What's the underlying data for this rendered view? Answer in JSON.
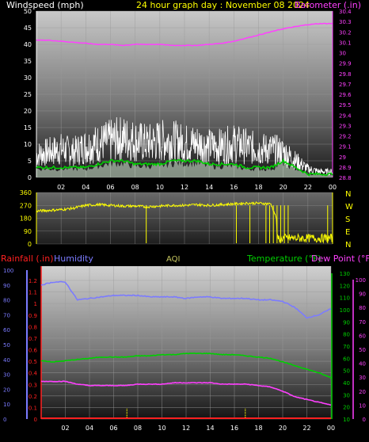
{
  "header": {
    "wind_label": "Windspeed (mph)",
    "day_label": "24 hour graph day : November 08 2024",
    "baro_label": "Barometer (.in)"
  },
  "lower_header": {
    "rain_label": "Rainfall (.in)",
    "humidity_label": "Humidity",
    "aqi_label": "AQI",
    "temp_label": "Temperature (°F)",
    "dew_label": "Dew Point (°F)"
  },
  "colors": {
    "wind_axis": "#ffffff",
    "barometer": "#ff40ff",
    "avg_wind": "#00d000",
    "gust": "#ffffff",
    "wind_dir": "#ffff00",
    "rain": "#ff2020",
    "humidity": "#7b7bff",
    "temperature": "#00d000",
    "dew_point": "#ff40ff"
  },
  "chart_data": [
    {
      "type": "line",
      "title": "24 hour graph day : November 08 2024",
      "x_ticks": [
        "02",
        "04",
        "06",
        "08",
        "10",
        "12",
        "14",
        "16",
        "18",
        "20",
        "22",
        "00"
      ],
      "left_axis": {
        "label": "Windspeed (mph)",
        "range": [
          0,
          50
        ],
        "ticks": [
          "0",
          "5",
          "10",
          "15",
          "20",
          "25",
          "30",
          "35",
          "40",
          "45",
          "50"
        ]
      },
      "right_axis": {
        "label": "Barometer (.in)",
        "range": [
          28.8,
          30.4
        ],
        "ticks": [
          "28.8",
          "28.9",
          "29",
          "29.1",
          "29.2",
          "29.3",
          "29.4",
          "29.5",
          "29.6",
          "29.7",
          "29.8",
          "29.9",
          "30",
          "30.1",
          "30.2",
          "30.3",
          "30.4"
        ]
      },
      "series": [
        {
          "name": "Barometer (.in)",
          "x": [
            0,
            1,
            2,
            3,
            4,
            5,
            6,
            7,
            8,
            9,
            10,
            11,
            12,
            13,
            14,
            15,
            16,
            17,
            18,
            19,
            20,
            21,
            22,
            23,
            24
          ],
          "values": [
            30.12,
            30.12,
            30.11,
            30.1,
            30.09,
            30.08,
            30.08,
            30.07,
            30.08,
            30.08,
            30.08,
            30.07,
            30.07,
            30.07,
            30.08,
            30.09,
            30.11,
            30.14,
            30.17,
            30.2,
            30.23,
            30.25,
            30.27,
            30.28,
            30.28
          ]
        },
        {
          "x": [
            0,
            1,
            2,
            3,
            4,
            5,
            6,
            7,
            8,
            9,
            10,
            11,
            12,
            13,
            14,
            15,
            16,
            17,
            18,
            19,
            20,
            21,
            22,
            23,
            24
          ],
          "values": [
            8,
            9,
            10,
            9,
            11,
            12,
            13,
            14,
            13,
            12,
            13,
            13,
            12,
            12,
            11,
            11,
            12,
            11,
            10,
            10,
            9,
            6,
            3,
            2,
            2
          ]
        },
        {
          "x": [
            0,
            1,
            2,
            3,
            4,
            5,
            6,
            7,
            8,
            9,
            10,
            11,
            12,
            13,
            14,
            15,
            16,
            17,
            18,
            19,
            20,
            21,
            22,
            23,
            24
          ],
          "values": [
            3,
            3,
            3,
            3,
            3,
            4,
            5,
            5,
            4,
            4,
            4,
            5,
            5,
            5,
            4,
            4,
            4,
            3,
            3,
            3,
            5,
            3,
            1,
            1,
            1
          ]
        }
      ],
      "grid": true
    },
    {
      "type": "scatter",
      "x_ticks": [
        "02",
        "04",
        "06",
        "08",
        "10",
        "12",
        "14",
        "16",
        "18",
        "20",
        "22",
        "00"
      ],
      "left_axis": {
        "range": [
          0,
          360
        ],
        "ticks": [
          "0",
          "90",
          "180",
          "270",
          "360"
        ]
      },
      "right_labels": [
        "N",
        "W",
        "S",
        "E",
        "N"
      ],
      "series": [
        {
          "x": [
            0,
            1,
            2,
            3,
            4,
            5,
            6,
            7,
            8,
            9,
            10,
            11,
            12,
            13,
            14,
            15,
            16,
            17,
            18,
            19,
            20,
            21,
            22,
            23,
            24
          ],
          "values": [
            230,
            235,
            240,
            250,
            270,
            275,
            270,
            265,
            265,
            260,
            265,
            270,
            270,
            275,
            270,
            275,
            280,
            285,
            285,
            280,
            60,
            20,
            30,
            40,
            200
          ]
        }
      ],
      "grid": true
    },
    {
      "type": "line",
      "x_ticks": [
        "02",
        "04",
        "06",
        "08",
        "10",
        "12",
        "14",
        "16",
        "18",
        "20",
        "22",
        "00"
      ],
      "left_axis_humidity": {
        "label": "Humidity",
        "range": [
          0,
          100
        ],
        "ticks": [
          "0",
          "10",
          "20",
          "30",
          "40",
          "50",
          "60",
          "70",
          "80",
          "90",
          "100"
        ]
      },
      "left_axis_rain": {
        "label": "Rainfall (.in)",
        "range": [
          0,
          1.2
        ],
        "ticks": [
          "0",
          "0.1",
          "0.2",
          "0.3",
          "0.4",
          "0.5",
          "0.6",
          "0.7",
          "0.8",
          "0.9",
          "1",
          "1.1",
          "1.2"
        ]
      },
      "right_axis_temp": {
        "label": "Temperature (°F)",
        "range": [
          10,
          130
        ],
        "ticks": [
          "10",
          "20",
          "30",
          "40",
          "50",
          "60",
          "70",
          "80",
          "90",
          "100",
          "110",
          "120",
          "130"
        ]
      },
      "right_axis_dew": {
        "label": "Dew Point (°F)",
        "range": [
          0,
          100
        ],
        "ticks": [
          "0",
          "10",
          "20",
          "30",
          "40",
          "50",
          "60",
          "70",
          "80",
          "90",
          "100"
        ]
      },
      "series": [
        {
          "name": "Humidity",
          "x": [
            0,
            1,
            2,
            3,
            4,
            5,
            6,
            7,
            8,
            9,
            10,
            11,
            12,
            13,
            14,
            15,
            16,
            17,
            18,
            19,
            20,
            21,
            22,
            23,
            24
          ],
          "values": [
            90,
            92,
            92,
            80,
            81,
            82,
            83,
            83,
            83,
            82,
            82,
            82,
            81,
            82,
            82,
            81,
            81,
            81,
            80,
            80,
            79,
            75,
            68,
            70,
            74
          ]
        },
        {
          "name": "Temperature (°F)",
          "x": [
            0,
            1,
            2,
            3,
            4,
            5,
            6,
            7,
            8,
            9,
            10,
            11,
            12,
            13,
            14,
            15,
            16,
            17,
            18,
            19,
            20,
            21,
            22,
            23,
            24
          ],
          "values": [
            58,
            57,
            58,
            59,
            60,
            61,
            61,
            61,
            62,
            62,
            63,
            63,
            64,
            64,
            64,
            63,
            63,
            62,
            61,
            60,
            57,
            54,
            51,
            48,
            44
          ]
        },
        {
          "name": "Dew Point (°F)",
          "x": [
            0,
            1,
            2,
            3,
            4,
            5,
            6,
            7,
            8,
            9,
            10,
            11,
            12,
            13,
            14,
            15,
            16,
            17,
            18,
            19,
            20,
            21,
            22,
            23,
            24
          ],
          "values": [
            27,
            27,
            27,
            25,
            24,
            24,
            24,
            24,
            25,
            25,
            25,
            26,
            26,
            26,
            26,
            25,
            25,
            25,
            24,
            23,
            20,
            16,
            14,
            12,
            10
          ]
        },
        {
          "name": "Rainfall (.in)",
          "x": [
            0,
            24
          ],
          "values": [
            0,
            0
          ]
        },
        {
          "name": "AQI",
          "x": [
            7.1,
            16.9
          ],
          "values": [
            12,
            12
          ]
        }
      ],
      "grid": true
    }
  ]
}
